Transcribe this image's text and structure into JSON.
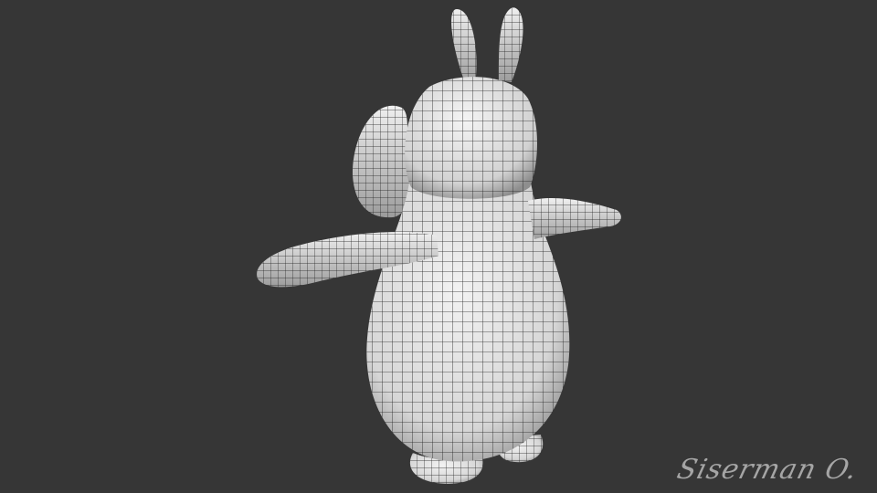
{
  "viewport": {
    "background_color": "#363636",
    "model_fill": "#e6e6e6",
    "model_shade": "#9a9a9a",
    "wire_color": "#1e1e1e",
    "description_icon": "wireframe-character-model"
  },
  "signature": {
    "text": "Siserman O."
  }
}
